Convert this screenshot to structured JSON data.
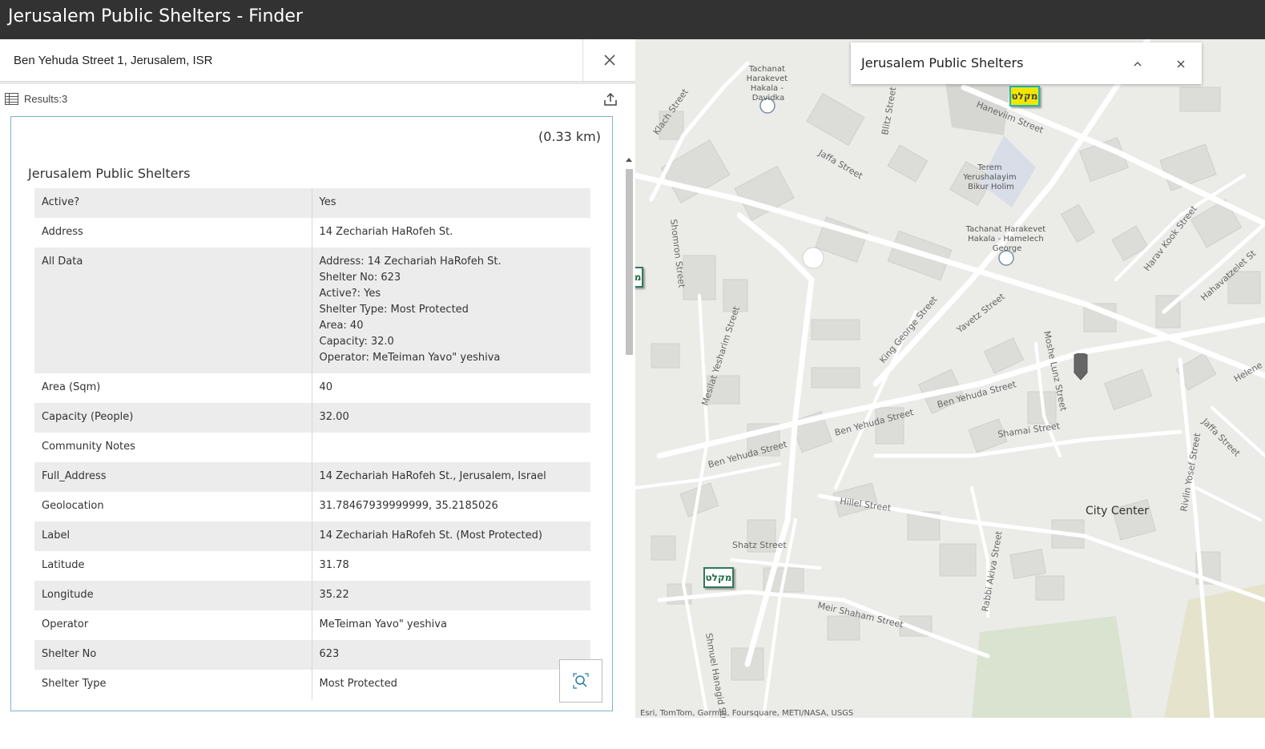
{
  "app": {
    "title": "Jerusalem Public Shelters - Finder"
  },
  "search": {
    "value": "Ben Yehuda Street 1, Jerusalem, ISR"
  },
  "results": {
    "label": "Results:3"
  },
  "card": {
    "distance": "(0.33 km)",
    "layer_title": "Jerusalem Public Shelters",
    "attributes": [
      {
        "key": "Active?",
        "value": [
          "Yes"
        ]
      },
      {
        "key": "Address",
        "value": [
          "14 Zechariah HaRofeh St."
        ]
      },
      {
        "key": "All Data",
        "value": [
          "Address: 14 Zechariah HaRofeh St.",
          "Shelter No: 623",
          "Active?: Yes",
          "Shelter Type: Most Protected",
          "Area: 40",
          "Capacity: 32.0",
          "Operator: MeTeiman Yavo\" yeshiva"
        ]
      },
      {
        "key": "Area (Sqm)",
        "value": [
          "40"
        ]
      },
      {
        "key": "Capacity (People)",
        "value": [
          "32.00"
        ]
      },
      {
        "key": "Community Notes",
        "value": [
          ""
        ]
      },
      {
        "key": "Full_Address",
        "value": [
          "14 Zechariah HaRofeh St., Jerusalem, Israel"
        ]
      },
      {
        "key": "Geolocation",
        "value": [
          "31.78467939999999, 35.2185026"
        ]
      },
      {
        "key": "Label",
        "value": [
          "14 Zechariah HaRofeh St. (Most Protected)"
        ]
      },
      {
        "key": "Latitude",
        "value": [
          "31.78"
        ]
      },
      {
        "key": "Longitude",
        "value": [
          "35.22"
        ]
      },
      {
        "key": "Operator",
        "value": [
          "MeTeiman Yavo\" yeshiva"
        ]
      },
      {
        "key": "Shelter No",
        "value": [
          "623"
        ]
      },
      {
        "key": "Shelter Type",
        "value": [
          "Most Protected"
        ]
      }
    ]
  },
  "map": {
    "popup_title": "Jerusalem Public Shelters",
    "marker_label": "מקלט",
    "district": "City Center",
    "streets": {
      "klach": "Klach Street",
      "haneviim": "Haneviim Street",
      "jaffa": "Jaffa Street",
      "jaffa2": "Jaffa Street",
      "blitz": "Blitz Street",
      "shomron": "Shomron Street",
      "mesilat": "Mesilat Yesharim Street",
      "kinggeorge": "King George Street",
      "yavetz": "Yavetz Street",
      "moshelunz": "Moshe Lunz Street",
      "benyehuda1": "Ben Yehuda Street",
      "benyehuda2": "Ben Yehuda Street",
      "benyehuda3": "Ben Yehuda Street",
      "shamai": "Shamai Street",
      "hillel": "Hillel Street",
      "shatz": "Shatz Street",
      "meirshaham": "Meir Shaham Street",
      "rabbiakiva": "Rabbi Akiva Street",
      "shmuelhanagid": "Shmuel Hanagid Street",
      "haravkook": "Harav Kook Street",
      "hahavatzelet": "Hahavatzelet St",
      "helene": "Helene",
      "rivlin": "Rivlin Yosef Street"
    },
    "pois": {
      "davidka": [
        "Tachanat",
        "Harakevet",
        "Hakala -",
        "Davidka"
      ],
      "terem": [
        "Terem",
        "Yerushalayim",
        "Bikur Holim"
      ],
      "hamelech": [
        "Tachanat Harakevet",
        "Hakala - Hamelech",
        "George"
      ]
    },
    "attribution": "Esri, TomTom, Garmin, Foursquare, METI/NASA, USGS"
  },
  "colors": {
    "topbar": "#323232",
    "selected_marker": "#f2e600",
    "shelter_marker_border": "#2f7a55"
  }
}
